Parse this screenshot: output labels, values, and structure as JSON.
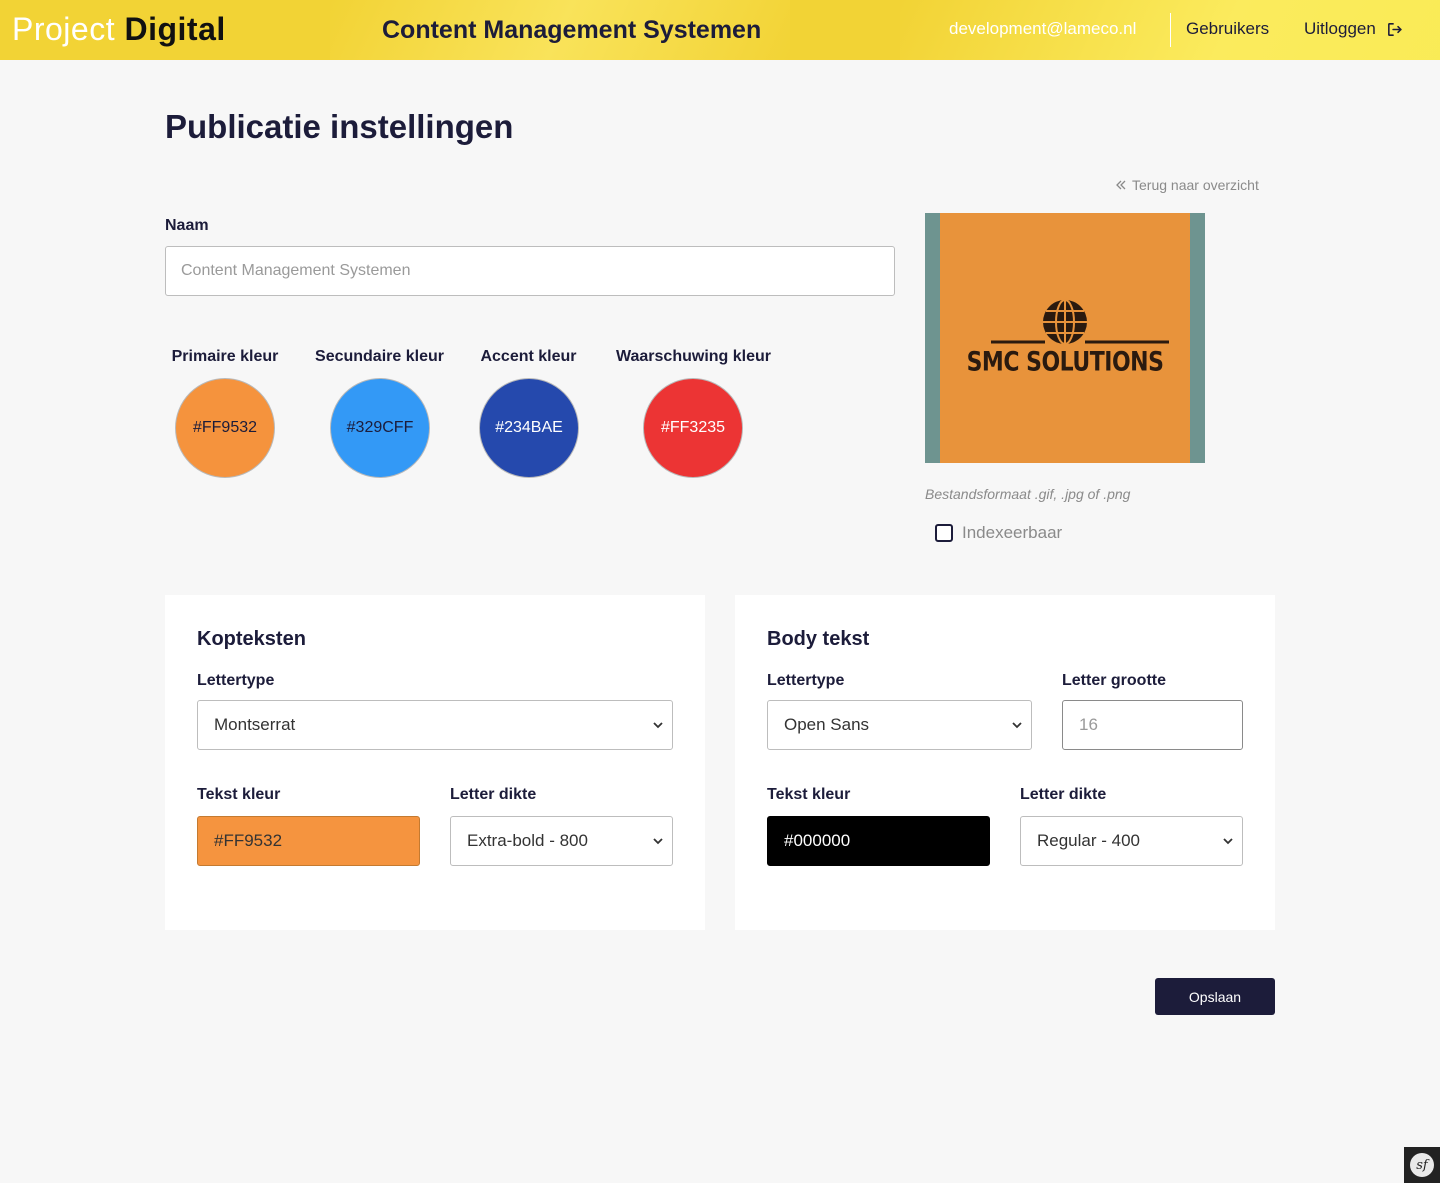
{
  "header": {
    "brand_light": "Project ",
    "brand_bold": "Digital",
    "title": "Content Management Systemen",
    "user_email": "development@lameco.nl",
    "nav_users": "Gebruikers",
    "nav_logout": "Uitloggen"
  },
  "page": {
    "title": "Publicatie instellingen",
    "back_link": "Terug naar overzicht"
  },
  "form": {
    "name_label": "Naam",
    "name_placeholder": "Content Management Systemen",
    "colors": [
      {
        "label": "Primaire kleur",
        "value": "#FF9532",
        "hex": "#f5933d",
        "text_color": "#1c1c3a"
      },
      {
        "label": "Secundaire kleur",
        "value": "#329CFF",
        "hex": "#3399f6",
        "text_color": "#1c1c3a"
      },
      {
        "label": "Accent kleur",
        "value": "#234BAE",
        "hex": "#2549ad",
        "text_color": "#ffffff"
      },
      {
        "label": "Waarschuwing kleur",
        "value": "#FF3235",
        "hex": "#ec3434",
        "text_color": "#ffffff"
      }
    ],
    "logo_text": "SMC SOLUTIONS",
    "file_hint": "Bestandsformaat .gif, .jpg of .png",
    "indexable_label": "Indexeerbaar"
  },
  "headings_card": {
    "title": "Kopteksten",
    "font_label": "Lettertype",
    "font_value": "Montserrat",
    "color_label": "Tekst kleur",
    "color_value": "#FF9532",
    "color_hex": "#f5943f",
    "weight_label": "Letter dikte",
    "weight_value": "Extra-bold - 800"
  },
  "body_card": {
    "title": "Body tekst",
    "font_label": "Lettertype",
    "font_value": "Open Sans",
    "size_label": "Letter grootte",
    "size_value": "16",
    "color_label": "Tekst kleur",
    "color_value": "#000000",
    "color_hex": "#000000",
    "weight_label": "Letter dikte",
    "weight_value": "Regular - 400"
  },
  "actions": {
    "save_label": "Opslaan"
  }
}
